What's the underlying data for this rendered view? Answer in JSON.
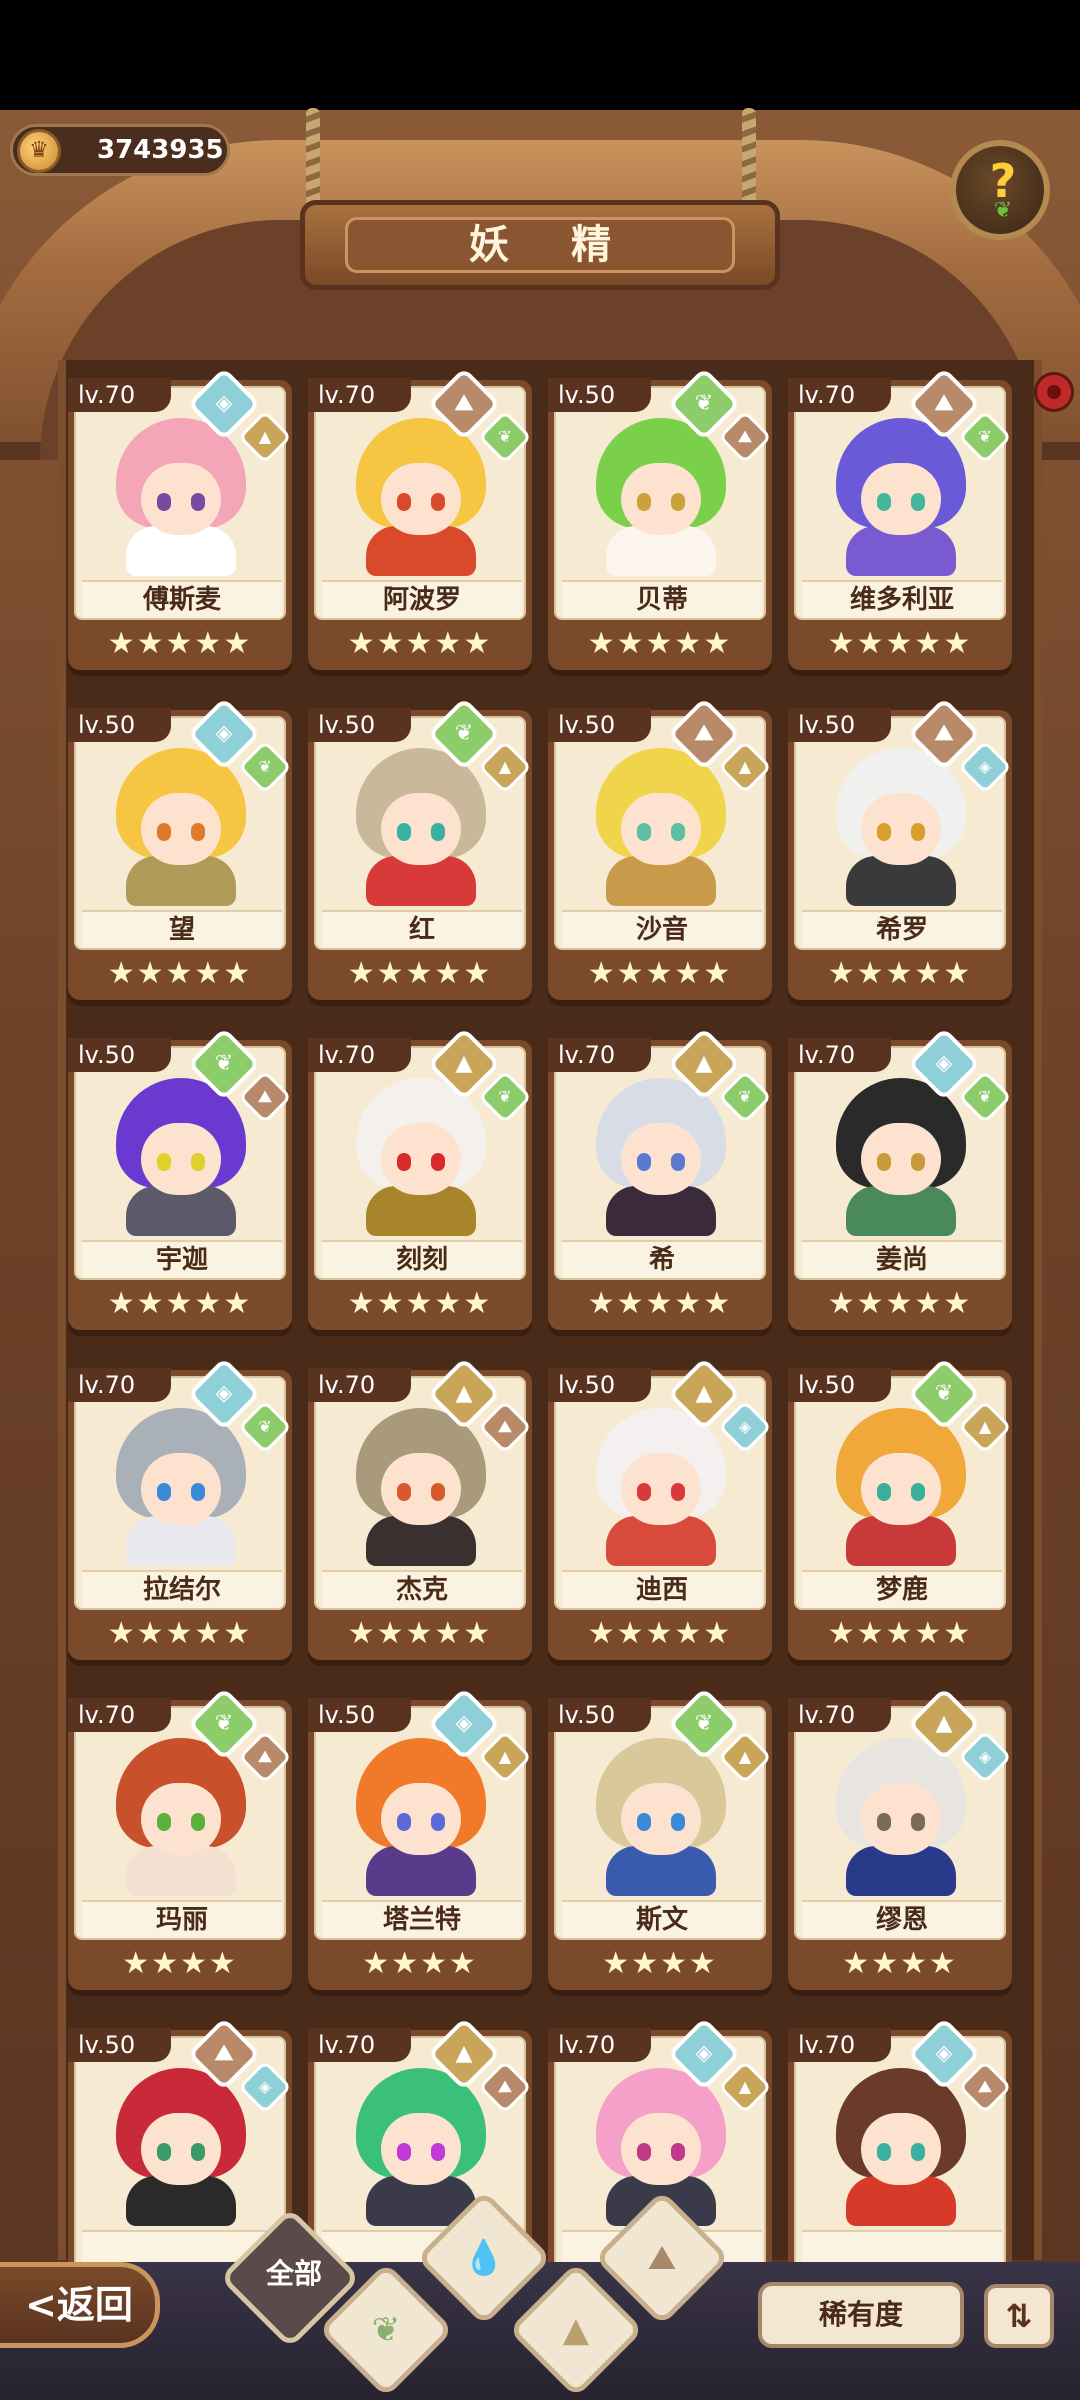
{
  "header": {
    "coins": "3743935",
    "title": "妖 精",
    "help_icon": "question-icon"
  },
  "cards": [
    {
      "level": "lv.70",
      "name": "傅斯麦",
      "stars": "★★★★★",
      "el": "water",
      "sub": "earth",
      "hair": "#f4a6b8",
      "eye": "#7a4aa0",
      "body": "#ffffff"
    },
    {
      "level": "lv.70",
      "name": "阿波罗",
      "stars": "★★★★★",
      "el": "mountain",
      "sub": "nature",
      "hair": "#f6c642",
      "eye": "#d84a2a",
      "body": "#d84a2a"
    },
    {
      "level": "lv.50",
      "name": "贝蒂",
      "stars": "★★★★★",
      "el": "nature",
      "sub": "mountain",
      "hair": "#7ad04a",
      "eye": "#caa23a",
      "body": "#fdf6ee"
    },
    {
      "level": "lv.70",
      "name": "维多利亚",
      "stars": "★★★★★",
      "el": "mountain",
      "sub": "nature",
      "hair": "#6a5ad8",
      "eye": "#42b89a",
      "body": "#7a5ad0"
    },
    {
      "level": "lv.50",
      "name": "望",
      "stars": "★★★★★",
      "el": "water",
      "sub": "nature",
      "hair": "#f6c642",
      "eye": "#e07a2a",
      "body": "#b09a5a"
    },
    {
      "level": "lv.50",
      "name": "红",
      "stars": "★★★★★",
      "el": "nature",
      "sub": "earth",
      "hair": "#c9b89a",
      "eye": "#3ab0a0",
      "body": "#d83a3a"
    },
    {
      "level": "lv.50",
      "name": "沙音",
      "stars": "★★★★★",
      "el": "mountain",
      "sub": "earth",
      "hair": "#f0d44a",
      "eye": "#5ac0a0",
      "body": "#c99a4a"
    },
    {
      "level": "lv.50",
      "name": "希罗",
      "stars": "★★★★★",
      "el": "mountain",
      "sub": "water",
      "hair": "#f0f0ee",
      "eye": "#d8a02a",
      "body": "#3a3a3a"
    },
    {
      "level": "lv.50",
      "name": "宇迦",
      "stars": "★★★★★",
      "el": "nature",
      "sub": "mountain",
      "hair": "#6a3ad0",
      "eye": "#e0d02a",
      "body": "#5a5a6a"
    },
    {
      "level": "lv.70",
      "name": "刻刻",
      "stars": "★★★★★",
      "el": "earth",
      "sub": "nature",
      "hair": "#f4f0ec",
      "eye": "#d82a2a",
      "body": "#a8842a"
    },
    {
      "level": "lv.70",
      "name": "希",
      "stars": "★★★★★",
      "el": "earth",
      "sub": "nature",
      "hair": "#d8dce6",
      "eye": "#5a7ad0",
      "body": "#3a2a3a"
    },
    {
      "level": "lv.70",
      "name": "姜尚",
      "stars": "★★★★★",
      "el": "water",
      "sub": "nature",
      "hair": "#2a2a2a",
      "eye": "#c99a3a",
      "body": "#4a8a5a"
    },
    {
      "level": "lv.70",
      "name": "拉结尔",
      "stars": "★★★★★",
      "el": "water",
      "sub": "nature",
      "hair": "#aab0b8",
      "eye": "#3a8ad8",
      "body": "#e8e8ee"
    },
    {
      "level": "lv.70",
      "name": "杰克",
      "stars": "★★★★★",
      "el": "earth",
      "sub": "mountain",
      "hair": "#a89a7a",
      "eye": "#d85a2a",
      "body": "#3a3030"
    },
    {
      "level": "lv.50",
      "name": "迪西",
      "stars": "★★★★★",
      "el": "earth",
      "sub": "water",
      "hair": "#f4f0f0",
      "eye": "#d83a3a",
      "body": "#d84a3a"
    },
    {
      "level": "lv.50",
      "name": "梦鹿",
      "stars": "★★★★★",
      "el": "nature",
      "sub": "earth",
      "hair": "#f0a83a",
      "eye": "#3ab09a",
      "body": "#c83a3a"
    },
    {
      "level": "lv.70",
      "name": "玛丽",
      "stars": "★★★★",
      "el": "nature",
      "sub": "mountain",
      "hair": "#c8502a",
      "eye": "#5ab03a",
      "body": "#f4e0d0"
    },
    {
      "level": "lv.50",
      "name": "塔兰特",
      "stars": "★★★★",
      "el": "water",
      "sub": "earth",
      "hair": "#f07a2a",
      "eye": "#5a6ad8",
      "body": "#5a3a8a"
    },
    {
      "level": "lv.50",
      "name": "斯文",
      "stars": "★★★★",
      "el": "nature",
      "sub": "earth",
      "hair": "#d8c89a",
      "eye": "#3a8ad8",
      "body": "#3a5ab0"
    },
    {
      "level": "lv.70",
      "name": "缪恩",
      "stars": "★★★★",
      "el": "earth",
      "sub": "water",
      "hair": "#e8e4e0",
      "eye": "#7a6a5a",
      "body": "#2a3a8a"
    },
    {
      "level": "lv.50",
      "name": "",
      "stars": "",
      "el": "mountain",
      "sub": "water",
      "hair": "#c82a3a",
      "eye": "#3a9a6a",
      "body": "#2a2a2a"
    },
    {
      "level": "lv.70",
      "name": "",
      "stars": "",
      "el": "earth",
      "sub": "mountain",
      "hair": "#3ac07a",
      "eye": "#c03ad8",
      "body": "#3a3a4a"
    },
    {
      "level": "lv.70",
      "name": "",
      "stars": "",
      "el": "water",
      "sub": "earth",
      "hair": "#f4a0c8",
      "eye": "#c03a8a",
      "body": "#3a3a4a"
    },
    {
      "level": "lv.70",
      "name": "",
      "stars": "",
      "el": "water",
      "sub": "mountain",
      "hair": "#6a3a2a",
      "eye": "#3ab0a0",
      "body": "#d83a2a"
    }
  ],
  "footer": {
    "back_label": "返回",
    "filter_all": "全部",
    "rarity_label": "稀有度",
    "sort_icon": "sort-icon"
  }
}
